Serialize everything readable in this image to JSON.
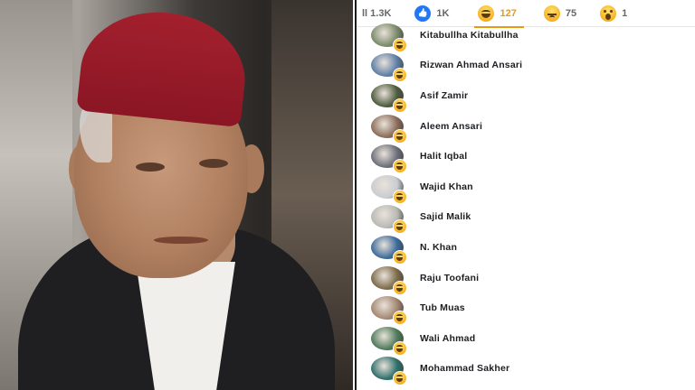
{
  "photo": {
    "alt_subject": "portrait"
  },
  "tabs": [
    {
      "label": "ll 1.3K",
      "icon": "all-reactions-icon",
      "active": false
    },
    {
      "label": "1K",
      "icon": "like-icon",
      "active": false
    },
    {
      "label": "127",
      "icon": "haha-icon",
      "active": true
    },
    {
      "label": "75",
      "icon": "sad-icon",
      "active": false
    },
    {
      "label": "1",
      "icon": "wow-icon",
      "active": false
    }
  ],
  "people": [
    {
      "name": "Kitabullha Kitabullha",
      "avatar_color": "#7a8a6a"
    },
    {
      "name": "Rizwan Ahmad Ansari",
      "avatar_color": "#5e7fa6"
    },
    {
      "name": "Asif Zamir",
      "avatar_color": "#4d5b3d"
    },
    {
      "name": "Aleem Ansari",
      "avatar_color": "#8a6d5a"
    },
    {
      "name": "Halit Iqbal",
      "avatar_color": "#6c6f7a"
    },
    {
      "name": "Wajid Khan",
      "avatar_color": "#c9ccd1"
    },
    {
      "name": "Sajid Malik",
      "avatar_color": "#b9b9b5"
    },
    {
      "name": "N. Khan",
      "avatar_color": "#3d6a9a"
    },
    {
      "name": "Raju Toofani",
      "avatar_color": "#7d6b4a"
    },
    {
      "name": "Tub Muas",
      "avatar_color": "#a48872"
    },
    {
      "name": "Wali Ahmad",
      "avatar_color": "#4f7a5b"
    },
    {
      "name": "Mohammad Sakher",
      "avatar_color": "#2f6f6a"
    }
  ],
  "colors": {
    "active_tab": "#e79a11",
    "text": "#1c1e21",
    "muted": "#65676b",
    "like": "#2078f4"
  }
}
